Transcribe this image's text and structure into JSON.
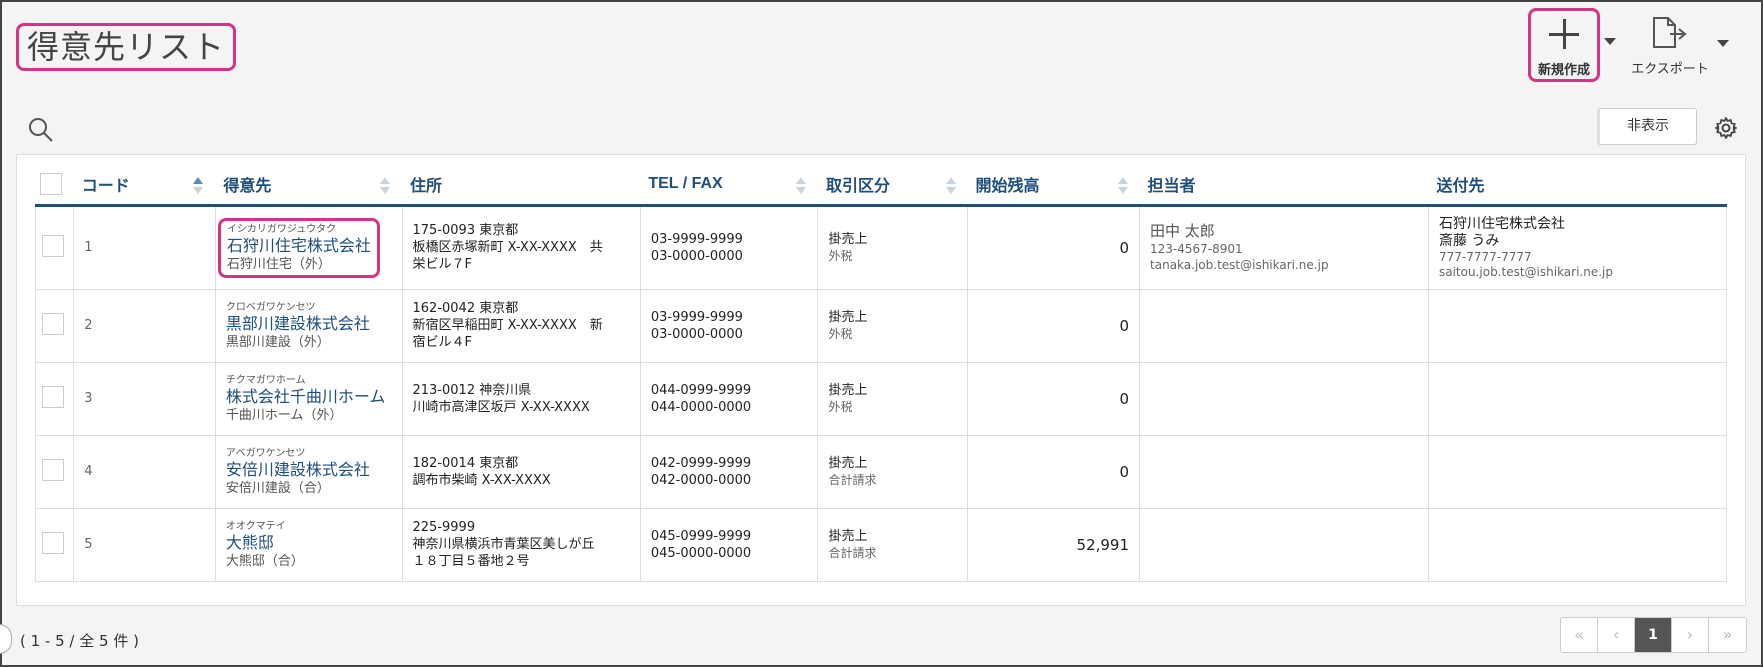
{
  "page": {
    "title": "得意先リスト"
  },
  "toolbar": {
    "new_label": "新規作成",
    "export_label": "エクスポート",
    "hide_label": "非表示"
  },
  "table": {
    "headers": {
      "code": "コード",
      "customer": "得意先",
      "address": "住所",
      "telfax": "TEL / FAX",
      "trade": "取引区分",
      "balance": "開始残高",
      "staff": "担当者",
      "dest": "送付先"
    },
    "rows": [
      {
        "code": "1",
        "kana": "イシカリガワジュウタク",
        "name": "石狩川住宅株式会社",
        "short": "石狩川住宅（外）",
        "addr1": "175-0093 東京都",
        "addr2": "板橋区赤塚新町 X-XX-XXXX　共",
        "addr3": "栄ビル７F",
        "tel": "03-9999-9999",
        "fax": "03-0000-0000",
        "trade": "掛売上",
        "tax": "外税",
        "balance": "0",
        "staff_name": "田中 太郎",
        "staff_tel": "123-4567-8901",
        "staff_mail": "tanaka.job.test@ishikari.ne.jp",
        "dest_company": "石狩川住宅株式会社",
        "dest_person": "斎藤 うみ",
        "dest_tel": "777-7777-7777",
        "dest_mail": "saitou.job.test@ishikari.ne.jp"
      },
      {
        "code": "2",
        "kana": "クロベガワケンセツ",
        "name": "黒部川建設株式会社",
        "short": "黒部川建設（外）",
        "addr1": "162-0042 東京都",
        "addr2": "新宿区早稲田町 X-XX-XXXX　新",
        "addr3": "宿ビル４F",
        "tel": "03-9999-9999",
        "fax": "03-0000-0000",
        "trade": "掛売上",
        "tax": "外税",
        "balance": "0"
      },
      {
        "code": "3",
        "kana": "チクマガワホーム",
        "name": "株式会社千曲川ホーム",
        "short": "千曲川ホーム（外）",
        "addr1": "213-0012 神奈川県",
        "addr2": "川崎市高津区坂戸 X-XX-XXXX",
        "addr3": "",
        "tel": "044-0999-9999",
        "fax": "044-0000-0000",
        "trade": "掛売上",
        "tax": "外税",
        "balance": "0"
      },
      {
        "code": "4",
        "kana": "アベガワケンセツ",
        "name": "安倍川建設株式会社",
        "short": "安倍川建設（合）",
        "addr1": "182-0014 東京都",
        "addr2": "調布市柴崎 X-XX-XXXX",
        "addr3": "",
        "tel": "042-0999-9999",
        "fax": "042-0000-0000",
        "trade": "掛売上",
        "tax": "合計請求",
        "balance": "0"
      },
      {
        "code": "5",
        "kana": "オオクマテイ",
        "name": "大熊邸",
        "short": "大熊邸（合）",
        "addr1": "225-9999",
        "addr2": "神奈川県横浜市青葉区美しが丘",
        "addr3": "１８丁目５番地２号",
        "tel": "045-0999-9999",
        "fax": "045-0000-0000",
        "trade": "掛売上",
        "tax": "合計請求",
        "balance": "52,991"
      }
    ]
  },
  "footer": {
    "count": "( 1 - 5 / 全 5 件 )",
    "pager": {
      "first": "«",
      "prev": "‹",
      "current": "1",
      "next": "›",
      "last": "»"
    }
  }
}
